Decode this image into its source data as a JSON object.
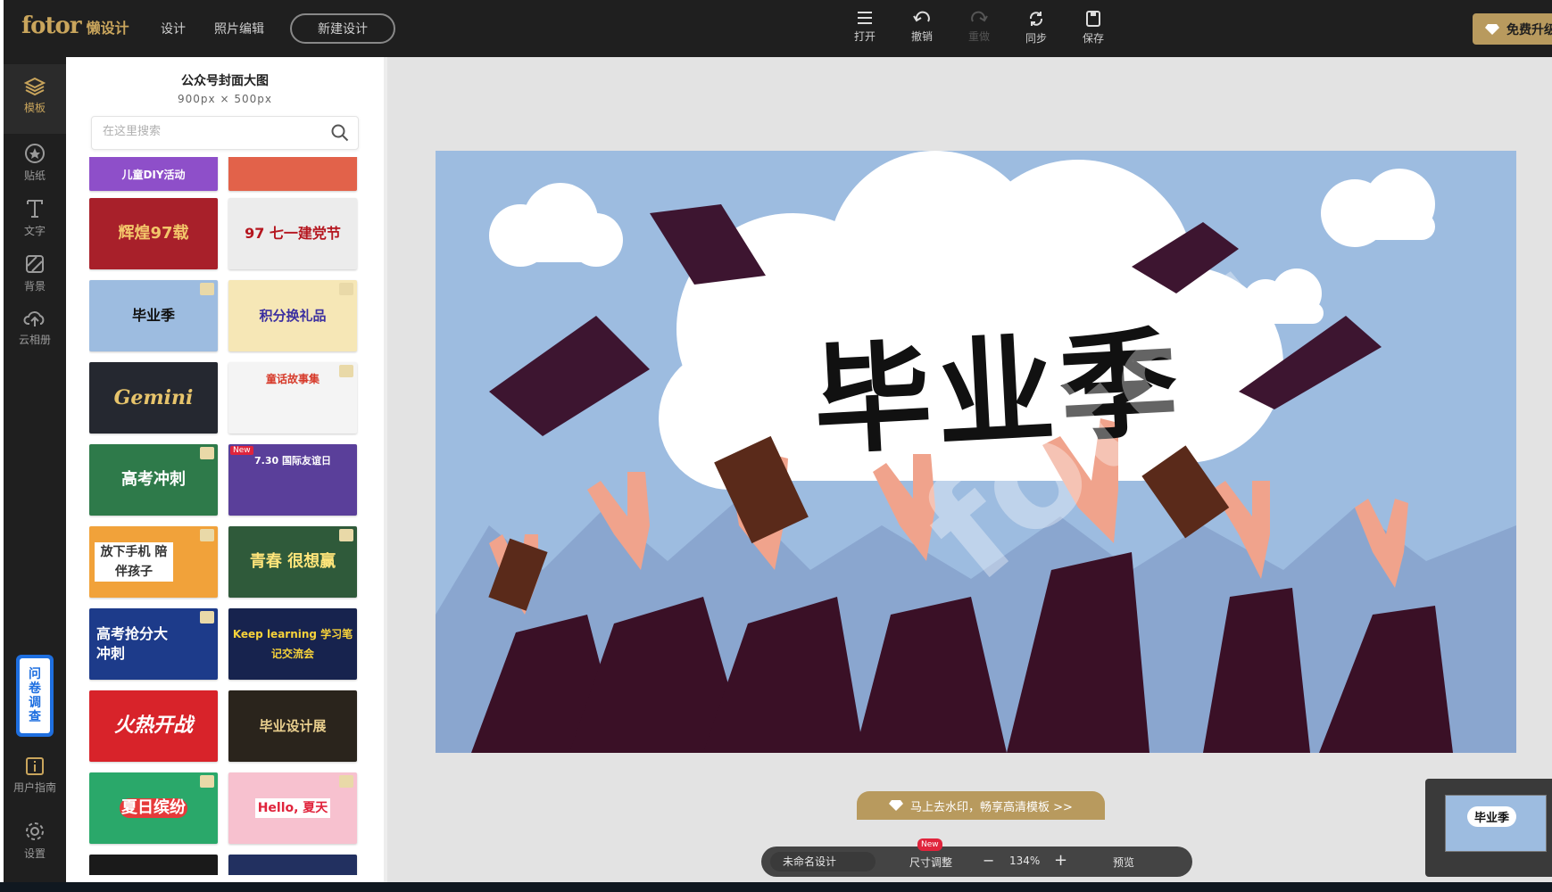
{
  "topbar": {
    "logo_brand": "fotor",
    "logo_sub": "懒设计",
    "nav": [
      "设计",
      "照片编辑"
    ],
    "new_design": "新建设计",
    "tools": [
      {
        "label": "打开",
        "icon": "menu-icon",
        "enabled": true
      },
      {
        "label": "撤销",
        "icon": "undo-icon",
        "enabled": true
      },
      {
        "label": "重做",
        "icon": "redo-icon",
        "enabled": false
      },
      {
        "label": "同步",
        "icon": "sync-icon",
        "enabled": true
      },
      {
        "label": "保存",
        "icon": "save-icon",
        "enabled": true
      }
    ],
    "upgrade": "免费升级"
  },
  "sidebar": {
    "items": [
      {
        "label": "模板",
        "icon": "layers-icon",
        "active": true
      },
      {
        "label": "贴纸",
        "icon": "star-icon",
        "active": false
      },
      {
        "label": "文字",
        "icon": "text-icon",
        "active": false
      },
      {
        "label": "背景",
        "icon": "background-icon",
        "active": false
      },
      {
        "label": "云相册",
        "icon": "cloud-upload-icon",
        "active": false
      }
    ],
    "survey": [
      "问",
      "卷",
      "调",
      "查"
    ],
    "guide": "用户指南",
    "settings": "设置"
  },
  "panel": {
    "title": "公众号封面大图",
    "size": "900px × 500px",
    "search_placeholder": "在这里搜索",
    "templates": [
      {
        "text": "儿童DIY活动",
        "bg": "#8e4fc9"
      },
      {
        "text": "",
        "bg": "#e2624a"
      },
      {
        "text": "辉煌97载",
        "bg": "#a8202a"
      },
      {
        "text": "97 七一建党节",
        "bg": "#ececec"
      },
      {
        "text": "毕业季",
        "bg": "#9dbce0"
      },
      {
        "text": "积分换礼品",
        "bg": "#f6e7b6"
      },
      {
        "text": "Gemini",
        "bg": "#252830"
      },
      {
        "text": "童话故事集",
        "bg": "#f4f4f4"
      },
      {
        "text": "高考冲刺",
        "bg": "#2e7a4a"
      },
      {
        "text": "7.30 国际友谊日",
        "bg": "#5a3f9a"
      },
      {
        "text": "放下手机 陪伴孩子",
        "bg": "#f1a23a"
      },
      {
        "text": "青春 很想赢",
        "bg": "#2f5a3a"
      },
      {
        "text": "高考抢分大冲刺",
        "bg": "#1d3b8a"
      },
      {
        "text": "Keep learning 学习笔记交流会",
        "bg": "#17234e"
      },
      {
        "text": "火热开战",
        "bg": "#d8232a"
      },
      {
        "text": "毕业设计展",
        "bg": "#2a241c"
      },
      {
        "text": "夏日缤纷",
        "bg": "#2aa86a"
      },
      {
        "text": "Hello, 夏天",
        "bg": "#f7c1cf"
      }
    ]
  },
  "canvas": {
    "title": "毕业季",
    "watermark": "fotor"
  },
  "bottom": {
    "promo": "马上去水印，畅享高清模板 >>",
    "design_name": "未命名设计",
    "resize": "尺寸调整",
    "new_badge": "New",
    "zoom": "134%",
    "preview": "预览"
  }
}
